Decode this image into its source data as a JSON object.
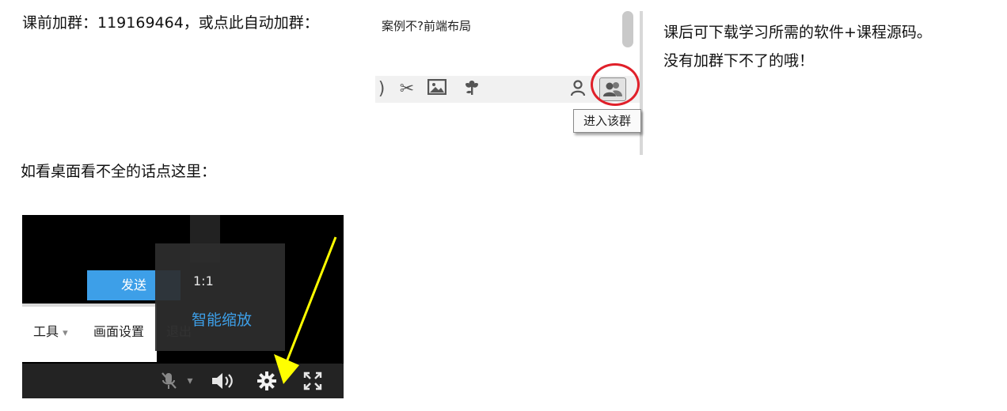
{
  "texts": {
    "top_line": "课前加群：119169464，或点此自动加群：",
    "right_line_1": "课后可下载学习所需的软件+课程源码。",
    "right_line_2": "没有加群下不了的哦！",
    "mid_line": "如看桌面看不全的话点这里："
  },
  "chat_window": {
    "title": "案例不?前端布局",
    "toolbar_icons": [
      "bracket-icon",
      "scissors-icon",
      "image-icon",
      "flower-icon",
      "user-icon",
      "group-icon"
    ],
    "tooltip": "进入该群",
    "highlight_color": "#e0202a"
  },
  "player_window": {
    "send_label": "发送",
    "menu": {
      "tools": "工具",
      "picture_settings": "画面设置",
      "exit": "退出",
      "tools_dropdown": "▾"
    },
    "popup": {
      "option_1to1": "1:1",
      "option_smart": "智能缩放"
    },
    "controls": [
      "mic-muted-icon",
      "chevron-down-icon",
      "volume-icon",
      "gear-icon",
      "fullscreen-icon"
    ],
    "accent_color": "#3d9fe8",
    "arrow_color": "#ffff00"
  }
}
